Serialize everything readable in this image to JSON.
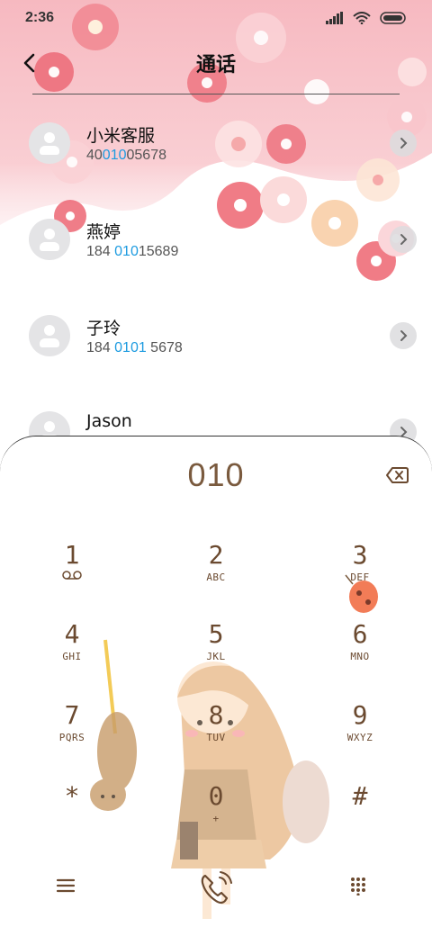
{
  "status_bar": {
    "time": "2:36",
    "icons": [
      "signal-icon",
      "wifi-icon",
      "battery-icon"
    ]
  },
  "header": {
    "title": "通话",
    "back_icon": "chevron-left-icon"
  },
  "contacts": [
    {
      "name": "小米客服",
      "number_parts": [
        "40",
        "010",
        "05678"
      ]
    },
    {
      "name": "燕婷",
      "number_parts": [
        "184 ",
        "010",
        "15689"
      ]
    },
    {
      "name": "子玲",
      "number_parts": [
        "184 ",
        "0101",
        " 5678"
      ]
    },
    {
      "name": "Jason",
      "number_parts": [
        "",
        "",
        ""
      ]
    }
  ],
  "dialpad": {
    "display": "010",
    "keys": [
      {
        "digit": "1",
        "letters": ""
      },
      {
        "digit": "2",
        "letters": "ABC"
      },
      {
        "digit": "3",
        "letters": "DEF"
      },
      {
        "digit": "4",
        "letters": "GHI"
      },
      {
        "digit": "5",
        "letters": "JKL"
      },
      {
        "digit": "6",
        "letters": "MNO"
      },
      {
        "digit": "7",
        "letters": "PQRS"
      },
      {
        "digit": "8",
        "letters": "TUV"
      },
      {
        "digit": "9",
        "letters": "WXYZ"
      },
      {
        "digit": "*",
        "letters": ""
      },
      {
        "digit": "0",
        "letters": "+"
      },
      {
        "digit": "#",
        "letters": ""
      }
    ],
    "bottom_icons": [
      "menu-icon",
      "phone-call-icon",
      "keypad-icon"
    ]
  },
  "colors": {
    "highlight": "#1d9be0",
    "keypad_brown": "#6b4a30",
    "flower_pink": "#f4a7b2"
  }
}
